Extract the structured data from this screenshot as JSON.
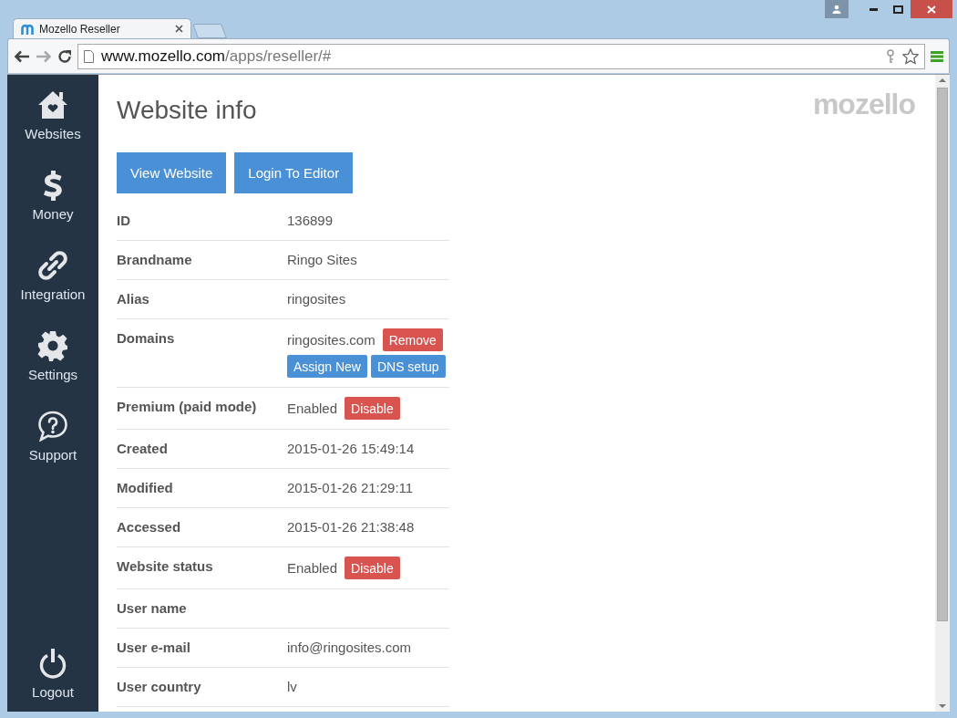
{
  "browser": {
    "tab_title": "Mozello Reseller",
    "url_host": "www.mozello.com",
    "url_path": "/apps/reseller/#"
  },
  "sidebar": {
    "items": [
      {
        "label": "Websites",
        "kind": "house"
      },
      {
        "label": "Money",
        "kind": "dollar"
      },
      {
        "label": "Integration",
        "kind": "link"
      },
      {
        "label": "Settings",
        "kind": "gear"
      },
      {
        "label": "Support",
        "kind": "question"
      }
    ],
    "logout": "Logout"
  },
  "page": {
    "title": "Website info",
    "logo": "mozello",
    "buttons": [
      "View Website",
      "Login To Editor"
    ],
    "rows": [
      {
        "label": "ID",
        "value": "136899",
        "buttons": []
      },
      {
        "label": "Brandname",
        "value": "Ringo Sites",
        "buttons": []
      },
      {
        "label": "Alias",
        "value": "ringosites",
        "buttons": []
      },
      {
        "label": "Domains",
        "value": "ringosites.com",
        "buttons": [
          {
            "label": "Remove",
            "kind": "danger"
          },
          {
            "label": "Assign New",
            "kind": "primary"
          },
          {
            "label": "DNS setup",
            "kind": "primary"
          }
        ]
      },
      {
        "label": "Premium (paid mode)",
        "value": "Enabled",
        "buttons": [
          {
            "label": "Disable",
            "kind": "danger"
          }
        ]
      },
      {
        "label": "Created",
        "value": "2015-01-26 15:49:14",
        "buttons": []
      },
      {
        "label": "Modified",
        "value": "2015-01-26 21:29:11",
        "buttons": []
      },
      {
        "label": "Accessed",
        "value": "2015-01-26 21:38:48",
        "buttons": []
      },
      {
        "label": "Website status",
        "value": "Enabled",
        "buttons": [
          {
            "label": "Disable",
            "kind": "danger"
          }
        ]
      },
      {
        "label": "User name",
        "buttons": []
      },
      {
        "label": "User e-mail",
        "value": "info@ringosites.com",
        "buttons": []
      },
      {
        "label": "User country",
        "value": "lv",
        "buttons": []
      }
    ]
  }
}
